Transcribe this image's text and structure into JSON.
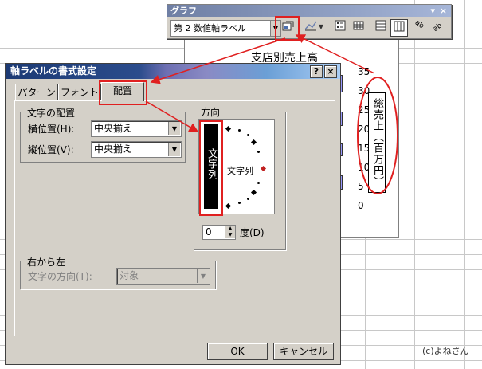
{
  "toolbar": {
    "title": "グラフ",
    "combo_value": "第 2 数値軸ラベル",
    "close_glyph": "×",
    "menu_glyph": "▾"
  },
  "chart": {
    "title": "支店別売上高",
    "y_ticks": [
      "35",
      "30",
      "25",
      "20",
      "15",
      "10",
      "5",
      "0"
    ],
    "axis_label": "総売上（百万円）"
  },
  "dialog": {
    "title": "軸ラベルの書式設定",
    "help_glyph": "?",
    "close_glyph": "×",
    "tabs": [
      "パターン",
      "フォント",
      "配置"
    ],
    "alignment_group": "文字の配置",
    "horizontal_label": "横位置(H):",
    "horizontal_value": "中央揃え",
    "vertical_label": "縦位置(V):",
    "vertical_value": "中央揃え",
    "orientation_group": "方向",
    "vertical_text": "文字列",
    "horizontal_text": "文字列",
    "degree_value": "0",
    "degree_label": "度(D)",
    "rtl_group": "右から左",
    "text_direction_label": "文字の方向(T):",
    "text_direction_value": "対象",
    "ok": "OK",
    "cancel": "キャンセル"
  },
  "watermark": "(c)よねさん",
  "colors": {
    "highlight": "#e02020",
    "title_bar": "#2b4c8c",
    "face": "#d4d0c8"
  }
}
